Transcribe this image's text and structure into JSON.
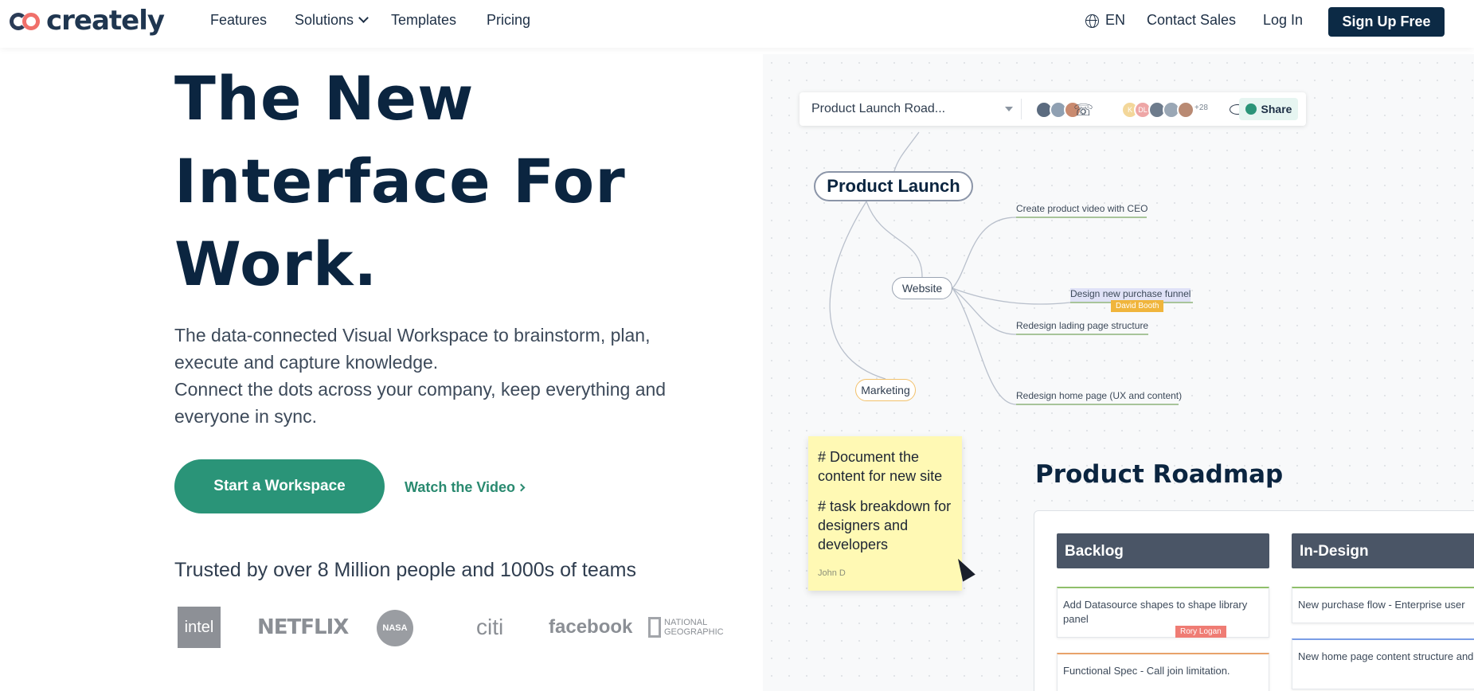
{
  "nav": {
    "logo": "creately",
    "links": [
      "Features",
      "Solutions",
      "Templates",
      "Pricing"
    ],
    "language": "EN",
    "contact": "Contact Sales",
    "login": "Log In",
    "signup": "Sign Up Free"
  },
  "hero": {
    "title_lines": [
      "The New",
      "Interface For",
      "Work."
    ],
    "subtitle_1": "The data-connected Visual Workspace to brainstorm, plan, execute and capture knowledge.",
    "subtitle_2": "Connect the dots across your company, keep everything and everyone in sync.",
    "cta": "Start a Workspace",
    "watch": "Watch the Video"
  },
  "trusted": {
    "heading": "Trusted by over 8 Million people and 1000s of teams",
    "logos": [
      "intel",
      "NETFLIX",
      "NASA",
      "citi",
      "facebook",
      "NATIONAL",
      "GEOGRAPHIC"
    ]
  },
  "canvas": {
    "toolbar": {
      "doc_title": "Product Launch Road...",
      "extra_count": "+28",
      "share": "Share",
      "avatar_letters": [
        "K",
        "DL"
      ]
    },
    "mindmap": {
      "root": "Product Launch",
      "website": "Website",
      "marketing": "Marketing",
      "leaves": [
        "Create product video with CEO",
        "Design new purchase funnel",
        "Redesign lading page structure",
        "Redesign home page (UX and content)"
      ],
      "cursor_tag": "David Booth"
    },
    "sticky": {
      "line1": "# Document the content for new site",
      "line2": "# task breakdown for designers and developers",
      "author": "John D"
    },
    "roadmap": {
      "title": "Product Roadmap",
      "columns": [
        {
          "name": "Backlog",
          "cards": [
            "Add Datasource shapes to shape library panel",
            "Functional Spec - Call join limitation."
          ]
        },
        {
          "name": "In-Design",
          "cards": [
            "New purchase flow - Enterprise user",
            "New home page content structure and behavior"
          ]
        }
      ],
      "card_tag": "Rory Logan"
    },
    "colors": {
      "accent": "#2a9478",
      "navy": "#0c2a45",
      "sticky": "#fff9b4",
      "tag_yellow": "#f0b53c",
      "tag_red": "#ef7c74"
    }
  }
}
